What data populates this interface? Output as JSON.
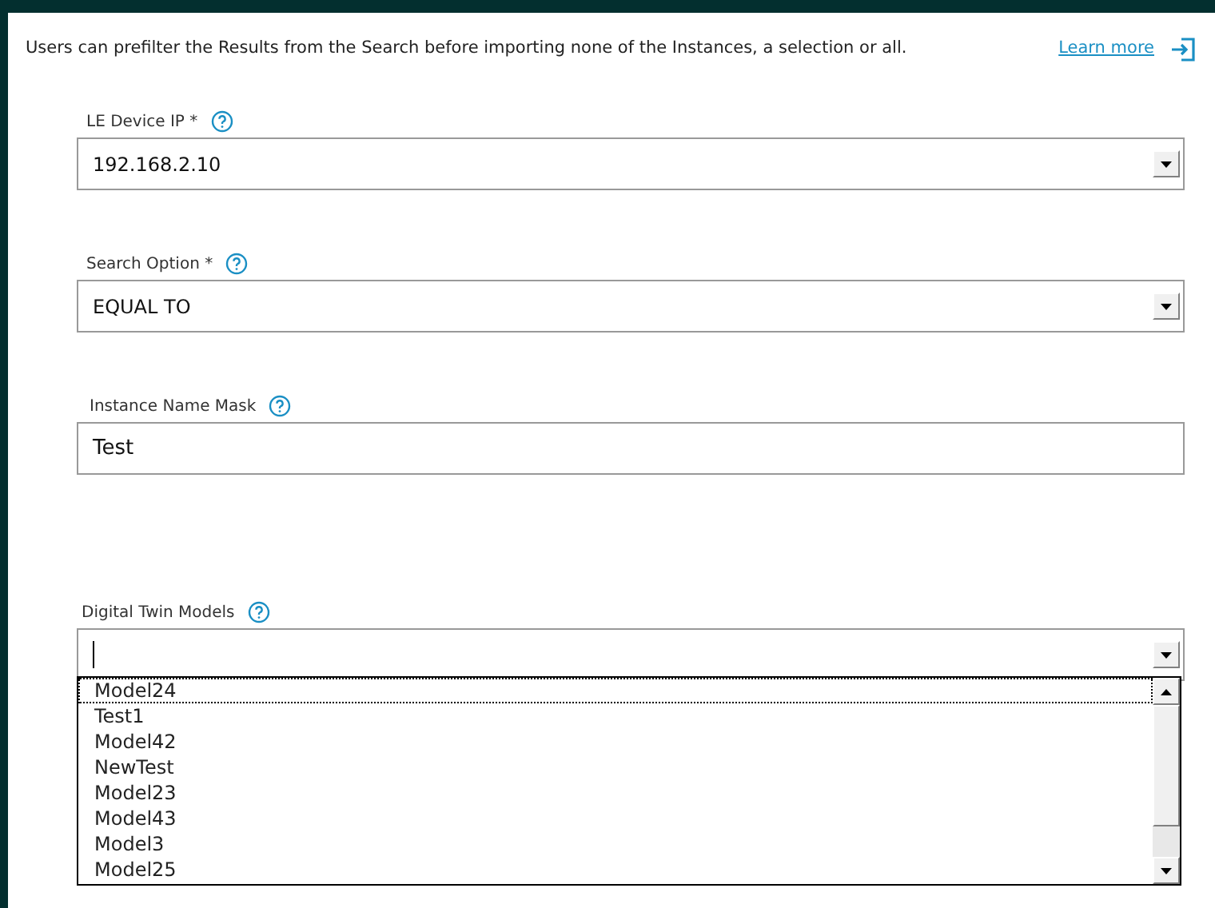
{
  "intro": {
    "text": "Users can prefilter the Results from the Search before importing none of the Instances, a selection or all.",
    "link": "Learn more"
  },
  "fields": [
    {
      "kind": "select",
      "label": "LE Device IP *",
      "value": "192.168.2.10"
    },
    {
      "kind": "select",
      "label": "Search Option *",
      "value": "EQUAL TO"
    },
    {
      "kind": "text",
      "label": "Instance Name Mask",
      "value": "Test"
    },
    {
      "kind": "combo",
      "label": "Digital Twin Models",
      "expanded": true,
      "options": [
        {
          "label": "Model24",
          "focused": true
        },
        {
          "label": "Test1",
          "focused": false
        },
        {
          "label": "Model42",
          "focused": false
        },
        {
          "label": "NewTest",
          "focused": false
        },
        {
          "label": "Model23",
          "focused": false
        },
        {
          "label": "Model43",
          "focused": false
        },
        {
          "label": "Model3",
          "focused": false
        },
        {
          "label": "Model25",
          "focused": false
        }
      ]
    }
  ]
}
